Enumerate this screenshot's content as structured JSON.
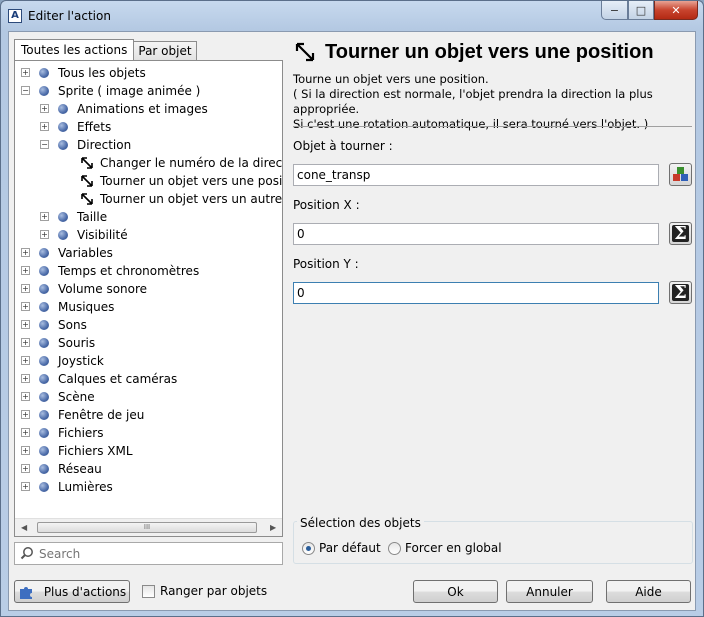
{
  "window": {
    "title": "Editer l'action",
    "app_icon": "A",
    "min_symbol": "−",
    "max_symbol": "□",
    "close_symbol": "✕"
  },
  "tabs": [
    {
      "label": "Toutes les actions"
    },
    {
      "label": "Par objet"
    }
  ],
  "tree": {
    "items": [
      {
        "label": "Tous les objets"
      },
      {
        "label": "Sprite ( image animée )"
      },
      {
        "label": "Animations et images"
      },
      {
        "label": "Effets"
      },
      {
        "label": "Direction"
      },
      {
        "label": "Changer le numéro de la direction"
      },
      {
        "label": "Tourner un objet vers une position"
      },
      {
        "label": "Tourner un objet vers un autre"
      },
      {
        "label": "Taille"
      },
      {
        "label": "Visibilité"
      },
      {
        "label": "Variables"
      },
      {
        "label": "Temps et chronomètres"
      },
      {
        "label": "Volume sonore"
      },
      {
        "label": "Musiques"
      },
      {
        "label": "Sons"
      },
      {
        "label": "Souris"
      },
      {
        "label": "Joystick"
      },
      {
        "label": "Calques et caméras"
      },
      {
        "label": "Scène"
      },
      {
        "label": "Fenêtre de jeu"
      },
      {
        "label": "Fichiers"
      },
      {
        "label": "Fichiers XML"
      },
      {
        "label": "Réseau"
      },
      {
        "label": "Lumières"
      }
    ],
    "scroll_thumb": "III"
  },
  "search": {
    "placeholder": "Search"
  },
  "action": {
    "title": "Tourner un objet vers une position",
    "description_lines": [
      "Tourne un objet vers une position.",
      "( Si la direction est normale, l'objet prendra la direction la plus appropriée.",
      "Si c'est une rotation automatique, il sera tourné vers l'objet. )"
    ],
    "params": [
      {
        "label": "Objet à tourner :",
        "value": "cone_transp",
        "button_icon": "objects-icon"
      },
      {
        "label": "Position X :",
        "value": "0",
        "button_icon": "sigma-icon"
      },
      {
        "label": "Position Y :",
        "value": "0",
        "button_icon": "sigma-icon"
      }
    ],
    "sigma_symbol": "Σ"
  },
  "selection": {
    "title": "Sélection des objets",
    "options": [
      {
        "label": "Par défaut",
        "checked": true
      },
      {
        "label": "Forcer en global",
        "checked": false
      }
    ]
  },
  "footer": {
    "more_actions": "Plus d'actions",
    "sort_by_objects": "Ranger par objets",
    "ok": "Ok",
    "cancel": "Annuler",
    "help": "Aide"
  }
}
